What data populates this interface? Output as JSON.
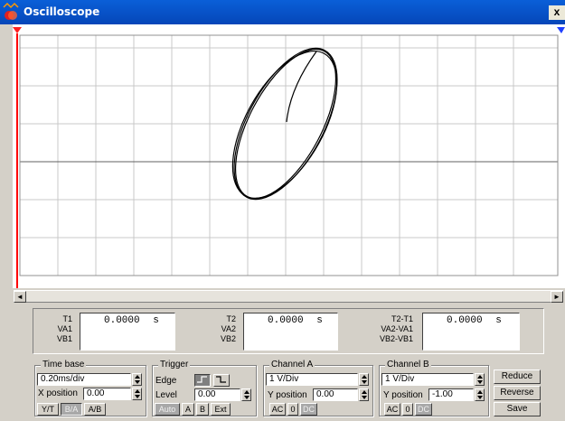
{
  "window": {
    "title": "Oscilloscope",
    "close_label": "x"
  },
  "cursors": {
    "t1": {
      "label": "T1",
      "value": "0.0000",
      "unit": "s",
      "rows": [
        "VA1",
        "VB1"
      ]
    },
    "t2": {
      "label": "T2",
      "value": "0.0000",
      "unit": "s",
      "rows": [
        "VA2",
        "VB2"
      ]
    },
    "diff": {
      "label": "T2-T1",
      "value": "0.0000",
      "unit": "s",
      "rows": [
        "VA2-VA1",
        "VB2-VB1"
      ]
    }
  },
  "time_base": {
    "title": "Time base",
    "scale": "0.20ms/div",
    "xpos_label": "X position",
    "xpos": "0.00",
    "modes": [
      "Y/T",
      "B/A",
      "A/B"
    ]
  },
  "trigger": {
    "title": "Trigger",
    "edge_label": "Edge",
    "level_label": "Level",
    "level": "0.00",
    "sources": [
      "Auto",
      "A",
      "B",
      "Ext"
    ]
  },
  "channel_a": {
    "title": "Channel A",
    "scale": "1  V/Div",
    "ypos_label": "Y position",
    "ypos": "0.00",
    "coupling": [
      "AC",
      "0",
      "DC"
    ]
  },
  "channel_b": {
    "title": "Channel B",
    "scale": "1  V/Div",
    "ypos_label": "Y position",
    "ypos": "-1.00",
    "coupling": [
      "AC",
      "0",
      "DC"
    ]
  },
  "actions": [
    "Reduce",
    "Reverse",
    "Save"
  ],
  "colors": {
    "title_bar": "#0546b8",
    "trace": "#000000",
    "grid": "#c0c0c0",
    "cursor1": "#ff0000",
    "cursor2": "#0000ff"
  },
  "display": {
    "mode": "B/A",
    "trace_shape": "tilted ellipse (Lissajous)"
  }
}
